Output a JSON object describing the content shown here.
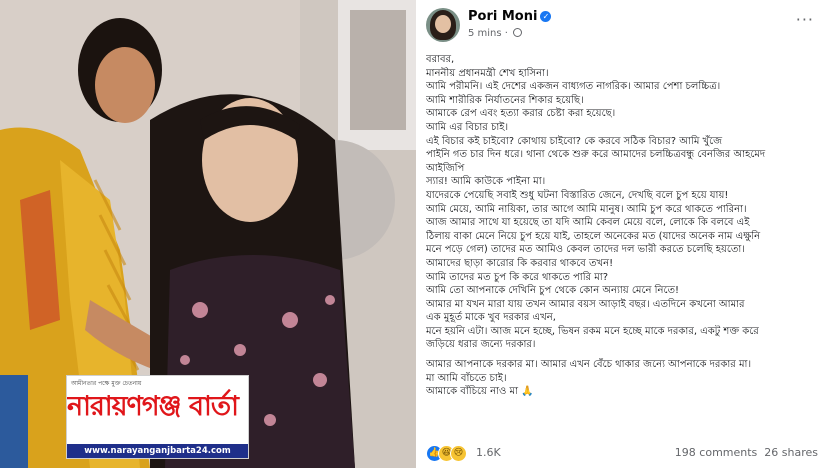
{
  "photo": {
    "logo": {
      "tagline": "আমীনতার পক্ষে মুক্ত চেতনায়",
      "brand": "নারায়ণগঞ্জ বার্তা ২৪",
      "url": "www.narayanganjbarta24.com"
    }
  },
  "post": {
    "author": "Pori Moni",
    "time": "5 mins",
    "lines": [
      "বরাবর,",
      "মাননীয় প্রধানমন্ত্রী শেখ হাসিনা।",
      "আমি পরীমনি। এই দেশের একজন বাধ্যগত নাগরিক। আমার পেশা চলচ্চিত্র।",
      "আমি শারীরিক নির্যাতনের শিকার হয়েছি।",
      "আমাকে রেপ এবং হত্যা করার চেষ্টা করা হয়েছে।",
      "আমি এর বিচার চাই।",
      "এই বিচার কই চাইবো? কোথায় চাইবো? কে করবে সঠিক বিচার? আমি খুঁজে",
      "পাইনি গত চার দিন ধরে। থানা থেকে শুরু করে আমাদের চলচ্চিত্রবন্ধু বেনজির আহমেদ",
      "আইজিপি",
      "স্যার! আমি কাউকে পাইনা মা।",
      "যাদেরকে পেয়েছি সবাই শুধু ঘটনা বিস্তারিত জেনে, দেখছি বলে চুপ হয়ে যায়!",
      "আমি মেয়ে, আমি নায়িকা, তার আগে আমি মানুষ। আমি চুপ করে থাকতে পারিনা।",
      "আজ আমার সাথে যা হয়েছে তা যদি আমি কেবল মেয়ে বলে, লোকে কি বলবে এই",
      "ঠিলায় বাকা মেনে নিয়ে চুপ হয়ে যাই, তাহলে অনেকের মত (যাদের অনেক নাম এক্ষুনি",
      "মনে পড়ে গেল) তাদের মত আমিও কেবল তাদের দল ভারী করতে চলেছি হয়তো।",
      "আমাদের ছাড়া কারোর কি করবার থাকবে তখন!",
      "আমি তাদের মত চুপ কি করে থাকতে পারি মা?",
      "আমি তো আপনাকে দেখিনি চুপ থেকে কোন অন্যায় মেনে নিতে!",
      "আমার মা যখন মারা যায় তখন আমার বয়স আড়াই বছর। এতদিনে কখনো আমার",
      "এক মুহূর্ত মাকে খুব দরকার এখন,",
      "মনে হয়নি এটা। আজ মনে হচ্ছে, ভিষন রকম মনে হচ্ছে মাকে দরকার, একটু শক্ত করে",
      "জড়িয়ে ধরার জন্যে দরকার।",
      "আমার আপনাকে দরকার মা। আমার এখন বেঁচে থাকার জন্যে আপনাকে দরকার মা।",
      "মা আমি বাঁচতে চাই।",
      "আমাকে বাঁচিয়ে নাও মা 🙏"
    ],
    "reactions": {
      "count": "1.6K",
      "comments": "198 comments",
      "shares": "26 shares"
    }
  },
  "colors": {
    "brand_red": "#e0161a",
    "url_bar": "#1f2f8a",
    "fb_blue": "#1877f2",
    "meta_gray": "#65676b"
  },
  "icons": [
    "verified-badge-icon",
    "globe-icon",
    "more-options-icon",
    "like-reaction-icon",
    "haha-reaction-icon",
    "sad-reaction-icon"
  ]
}
